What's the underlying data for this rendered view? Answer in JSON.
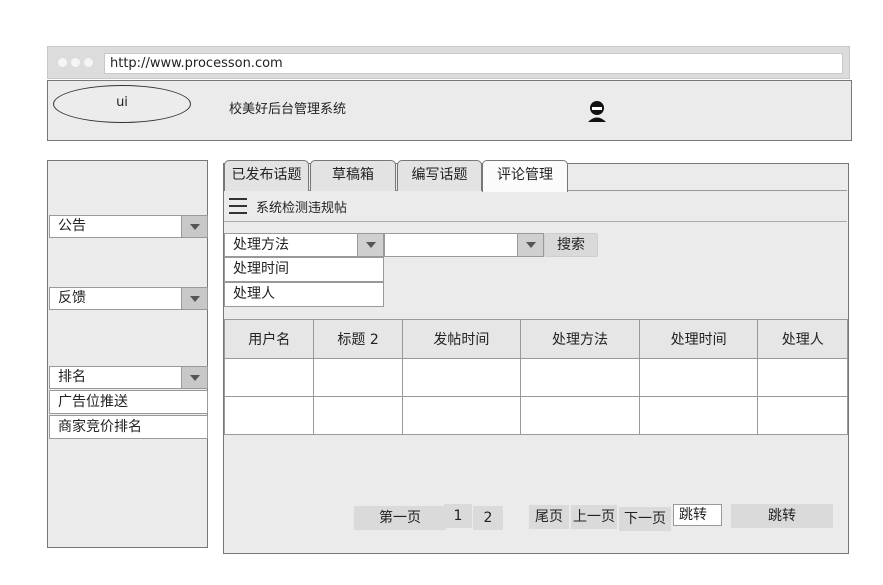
{
  "browser": {
    "url": "http://www.processon.com"
  },
  "header": {
    "logo": "ui",
    "title": "校美好后台管理系统"
  },
  "sidebar": {
    "dropdowns": [
      {
        "label": "公告"
      },
      {
        "label": "反馈"
      },
      {
        "label": "排名"
      }
    ],
    "items": [
      {
        "label": "广告位推送"
      },
      {
        "label": "商家竞价排名"
      }
    ]
  },
  "tabs": [
    {
      "label": "已发布话题"
    },
    {
      "label": "草稿箱"
    },
    {
      "label": "编写话题"
    },
    {
      "label": "评论管理",
      "active": true
    }
  ],
  "section": {
    "title": "系统检测违规帖"
  },
  "filters": {
    "method_select": "处理方法",
    "second_select": "",
    "search_button": "搜索",
    "options": [
      "处理时间",
      "处理人"
    ]
  },
  "table": {
    "columns": [
      "用户名",
      "标题 2",
      "发帖时间",
      "处理方法",
      "处理时间",
      "处理人"
    ],
    "rows": [
      [
        "",
        "",
        "",
        "",
        "",
        ""
      ],
      [
        "",
        "",
        "",
        "",
        "",
        ""
      ]
    ]
  },
  "pagination": {
    "first": "第一页",
    "page1": "1",
    "page2": "2",
    "last": "尾页",
    "prev": "上一页",
    "next": "下一页",
    "jump_input": "跳转",
    "jump_button": "跳转"
  },
  "colors": {
    "panel": "#ebebeb",
    "border": "#777777",
    "button": "#d9d9d9"
  }
}
